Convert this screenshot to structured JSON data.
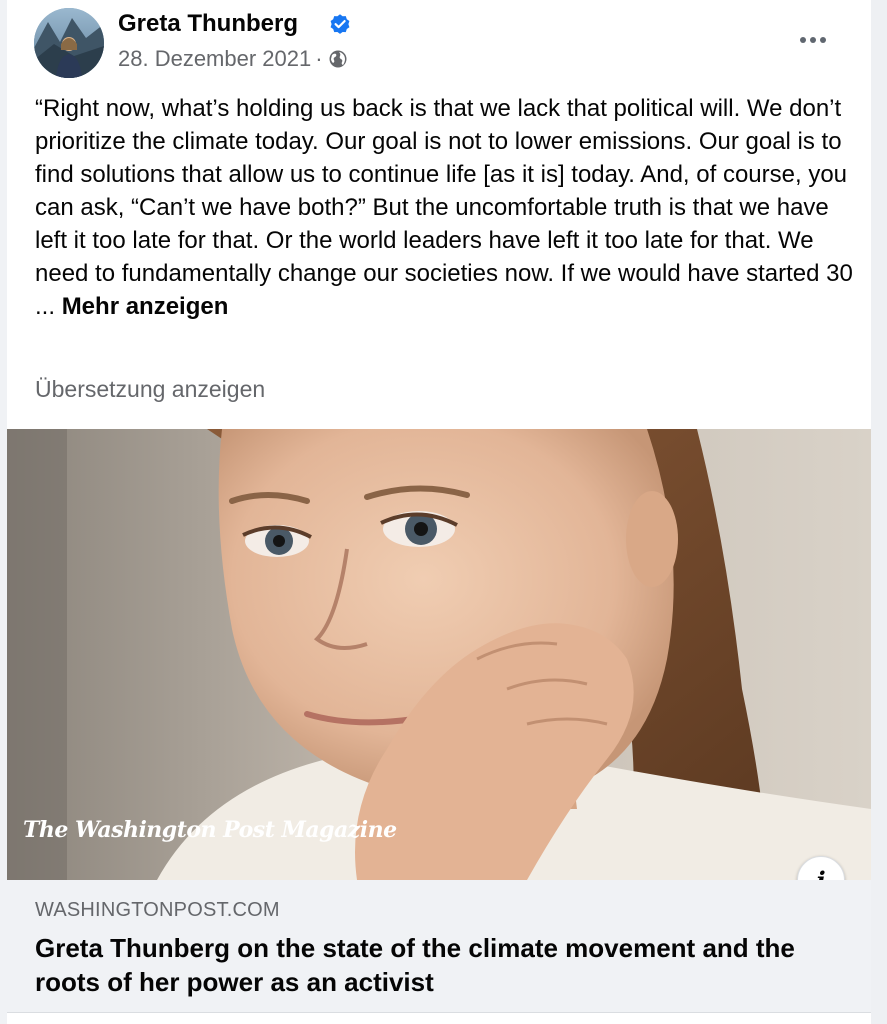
{
  "post": {
    "author": "Greta Thunberg",
    "date": "28. Dezember 2021",
    "meta_separator": "·",
    "text": "“Right now, what’s holding us back is that we lack that political will. We don’t prioritize the climate today. Our goal is not to lower emissions. Our goal is to find solutions that allow us to continue life [as it is] today. And, of course, you can ask, “Can’t we have both?” But the uncomfortable truth is that we have left it too late for that. Or the world leaders have left it too late for that. We need to fundamentally change our societies now. If we would have started 30 ...",
    "see_more": "Mehr anzeigen",
    "translate": "Übersetzung anzeigen"
  },
  "link": {
    "image_logo": "The Washington Post Magazine",
    "info_label": "i",
    "domain": "WASHINGTONPOST.COM",
    "title": "Greta Thunberg on the state of the climate movement and the roots of her power as an activist"
  },
  "colors": {
    "verified": "#1877f2",
    "secondary_text": "#65676b",
    "primary_text": "#050505",
    "link_bg": "#f0f2f5"
  },
  "icons": [
    "verified-badge-icon",
    "globe-icon",
    "more-options-icon",
    "info-icon"
  ]
}
